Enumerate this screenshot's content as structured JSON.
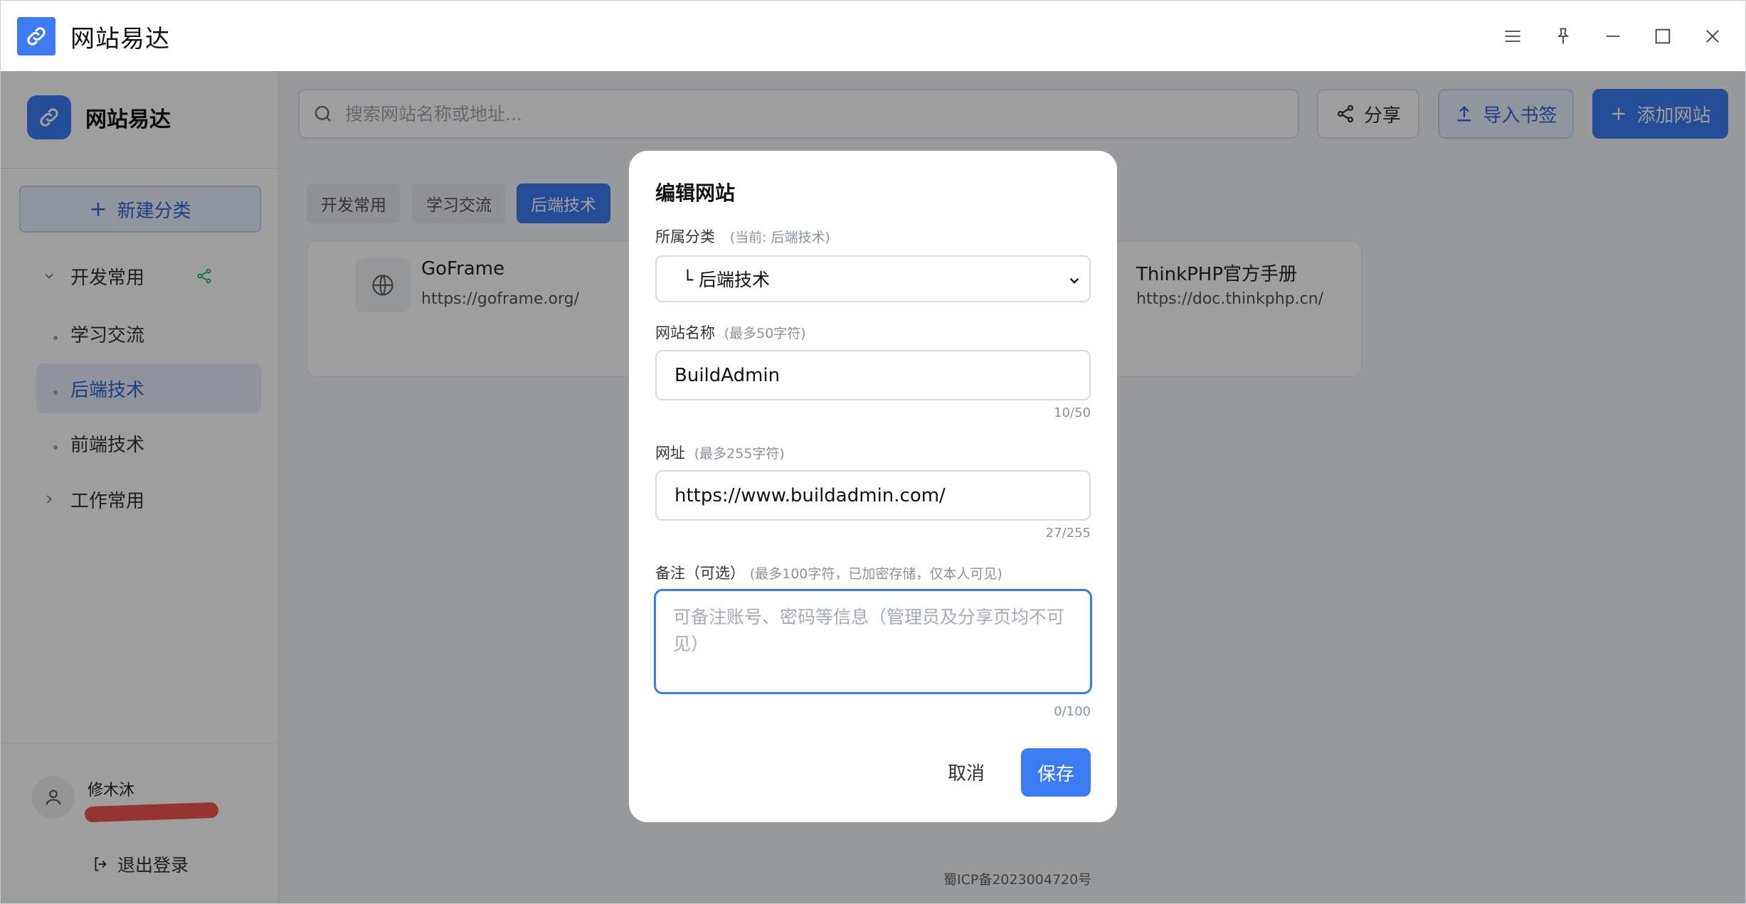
{
  "window": {
    "title": "网站易达",
    "controls": [
      "menu-icon",
      "pin-icon",
      "minimize-icon",
      "maximize-icon",
      "close-icon"
    ]
  },
  "sidebar": {
    "brand": "网站易达",
    "new_category": "新建分类",
    "categories": [
      {
        "label": "开发常用",
        "expanded": true,
        "shared": true
      },
      {
        "label": "工作常用",
        "expanded": false
      }
    ],
    "subcategories": [
      {
        "label": "学习交流",
        "active": false
      },
      {
        "label": "后端技术",
        "active": true
      },
      {
        "label": "前端技术",
        "active": false
      }
    ],
    "user": {
      "name": "修木沐"
    },
    "logout": "退出登录"
  },
  "toolbar": {
    "search_placeholder": "搜索网站名称或地址...",
    "share": "分享",
    "import": "导入书签",
    "add": "添加网站"
  },
  "tabs": [
    {
      "label": "开发常用",
      "active": false
    },
    {
      "label": "学习交流",
      "active": false
    },
    {
      "label": "后端技术",
      "active": true
    }
  ],
  "sites": [
    {
      "name": "GoFrame",
      "url": "https://goframe.org/"
    },
    {
      "name": "ThinkPHP官方手册",
      "url": "https://doc.thinkphp.cn/"
    }
  ],
  "footer": {
    "icp": "蜀ICP备2023004720号"
  },
  "modal": {
    "title": "编辑网站",
    "category_label": "所属分类",
    "category_hint": "(当前: 后端技术)",
    "category_value": "└ 后端技术",
    "name_label": "网站名称",
    "name_hint": "(最多50字符)",
    "name_value": "BuildAdmin",
    "name_count": "10/50",
    "url_label": "网址",
    "url_hint": "(最多255字符)",
    "url_value": "https://www.buildadmin.com/",
    "url_count": "27/255",
    "note_label": "备注（可选）",
    "note_hint": "(最多100字符，已加密存储，仅本人可见)",
    "note_placeholder": "可备注账号、密码等信息（管理员及分享页均不可见）",
    "note_count": "0/100",
    "cancel": "取消",
    "save": "保存"
  },
  "colors": {
    "accent": "#3d7bf2",
    "share_icon": "#2bb673"
  }
}
